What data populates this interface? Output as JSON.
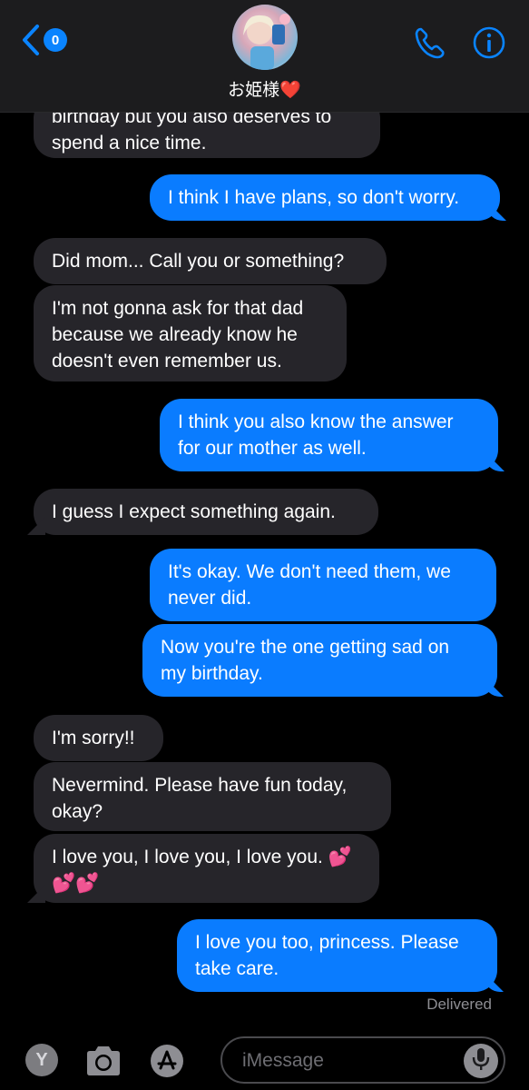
{
  "header": {
    "unread_count": "0",
    "contact_name": "お姫様",
    "contact_emoji": "❤️"
  },
  "messages": [
    {
      "side": "received",
      "text": "birthday but you also deserves to\nspend a nice time."
    },
    {
      "side": "sent",
      "text": "I think I have plans, so don't worry."
    },
    {
      "side": "received",
      "text": "Did mom... Call you or something?"
    },
    {
      "side": "received",
      "text": "I'm not gonna ask for that dad\nbecause we already know he\ndoesn't even remember us."
    },
    {
      "side": "sent",
      "text": "I think you also know the answer\nfor our mother as well."
    },
    {
      "side": "received",
      "text": "I guess I expect something again."
    },
    {
      "side": "sent",
      "text": "It's okay. We don't need them, we\nnever did."
    },
    {
      "side": "sent",
      "text": "Now you're the one getting sad on\nmy birthday."
    },
    {
      "side": "received",
      "text": "I'm sorry!!"
    },
    {
      "side": "received",
      "text": "Nevermind. Please have fun today,\nokay?"
    },
    {
      "side": "received",
      "text": "I love you, I love you, I love you. 💕\n💕💕"
    },
    {
      "side": "sent",
      "text": "I love you too, princess. Please\ntake care."
    }
  ],
  "status": {
    "delivered": "Delivered"
  },
  "input_bar": {
    "y_button": "Y",
    "placeholder": "iMessage"
  },
  "colors": {
    "accent": "#0a84ff",
    "sent_bubble": "#0a7cff",
    "received_bubble": "#26252a"
  },
  "icons": [
    "chevron-left-icon",
    "phone-icon",
    "info-icon",
    "camera-icon",
    "app-store-icon",
    "microphone-icon"
  ]
}
